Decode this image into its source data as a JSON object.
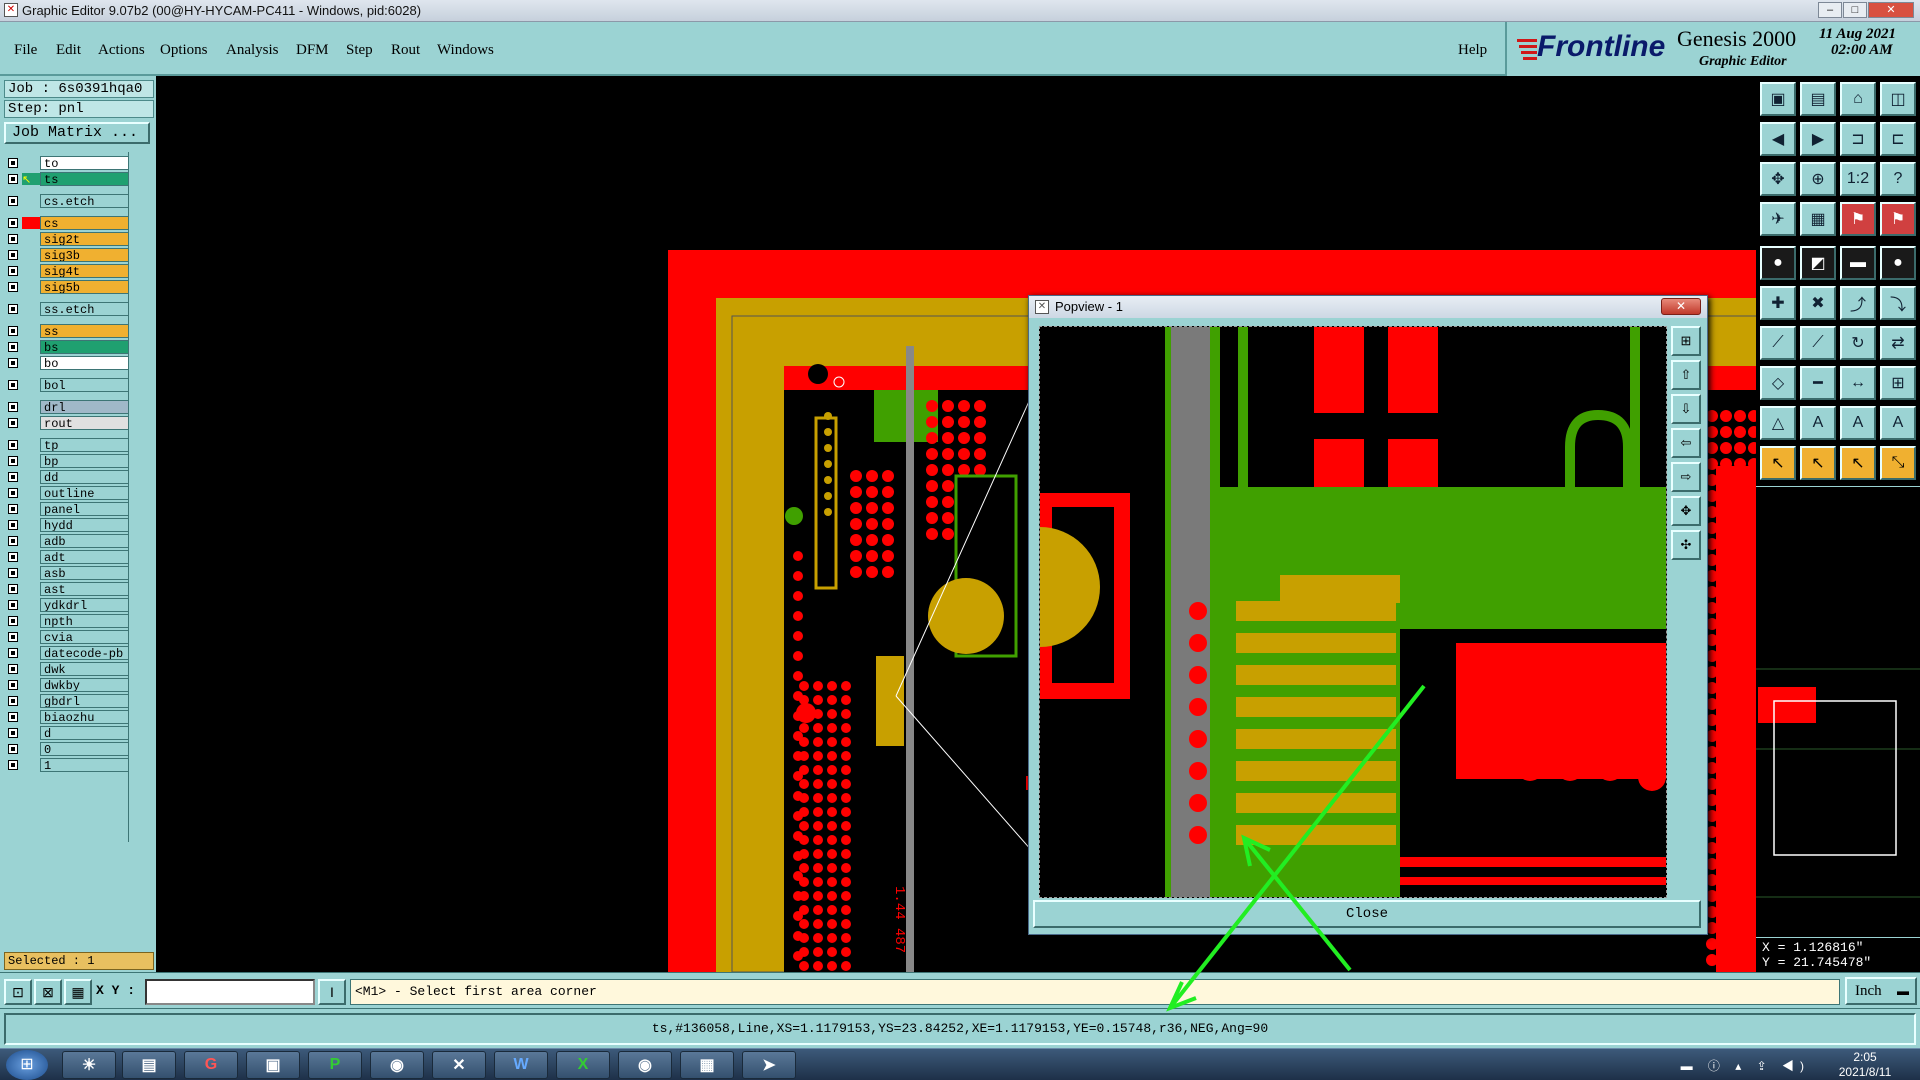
{
  "window": {
    "title": "Graphic Editor 9.07b2 (00@HY-HYCAM-PC411 - Windows, pid:6028)",
    "min": "–",
    "max": "□",
    "close": "✕"
  },
  "menu": [
    "File",
    "Edit",
    "Actions",
    "Options",
    "Analysis",
    "DFM",
    "Step",
    "Rout",
    "Windows"
  ],
  "help": "Help",
  "brand": {
    "logo": "Frontline",
    "product": "Genesis 2000",
    "sub": "Graphic Editor",
    "date": "11 Aug 2021",
    "time": "02:00 AM"
  },
  "job": "Job : 6s0391hqa0",
  "step": "Step: pnl",
  "job_matrix": "Job Matrix ...",
  "layers": [
    {
      "name": "to",
      "color": "#ffffff",
      "mark": ""
    },
    {
      "name": "ts",
      "color": "#1fa070",
      "mark": "sel"
    },
    {
      "name": "cs.etch",
      "color": "#9bd3d3",
      "mark": ""
    },
    {
      "name": "cs",
      "color": "#f0b030",
      "mark": "red"
    },
    {
      "name": "sig2t",
      "color": "#f0b030",
      "mark": ""
    },
    {
      "name": "sig3b",
      "color": "#f0b030",
      "mark": ""
    },
    {
      "name": "sig4t",
      "color": "#f0b030",
      "mark": ""
    },
    {
      "name": "sig5b",
      "color": "#f0b030",
      "mark": ""
    },
    {
      "name": "ss.etch",
      "color": "#9bd3d3",
      "mark": ""
    },
    {
      "name": "ss",
      "color": "#f0b030",
      "mark": ""
    },
    {
      "name": "bs",
      "color": "#1fa070",
      "mark": ""
    },
    {
      "name": "bo",
      "color": "#ffffff",
      "mark": ""
    },
    {
      "name": "bol",
      "color": "#9bd3d3",
      "mark": ""
    },
    {
      "name": "drl",
      "color": "#a0b8c8",
      "mark": ""
    },
    {
      "name": "rout",
      "color": "#e0e0e0",
      "mark": ""
    },
    {
      "name": "tp",
      "color": "#9bd3d3",
      "mark": ""
    },
    {
      "name": "bp",
      "color": "#9bd3d3",
      "mark": ""
    },
    {
      "name": "dd",
      "color": "#9bd3d3",
      "mark": ""
    },
    {
      "name": "outline",
      "color": "#9bd3d3",
      "mark": ""
    },
    {
      "name": "panel",
      "color": "#9bd3d3",
      "mark": ""
    },
    {
      "name": "hydd",
      "color": "#9bd3d3",
      "mark": ""
    },
    {
      "name": "adb",
      "color": "#9bd3d3",
      "mark": ""
    },
    {
      "name": "adt",
      "color": "#9bd3d3",
      "mark": ""
    },
    {
      "name": "asb",
      "color": "#9bd3d3",
      "mark": ""
    },
    {
      "name": "ast",
      "color": "#9bd3d3",
      "mark": ""
    },
    {
      "name": "ydkdrl",
      "color": "#9bd3d3",
      "mark": ""
    },
    {
      "name": "npth",
      "color": "#9bd3d3",
      "mark": ""
    },
    {
      "name": "cvia",
      "color": "#9bd3d3",
      "mark": ""
    },
    {
      "name": "datecode-pb",
      "color": "#9bd3d3",
      "mark": ""
    },
    {
      "name": "dwk",
      "color": "#9bd3d3",
      "mark": ""
    },
    {
      "name": "dwkby",
      "color": "#9bd3d3",
      "mark": ""
    },
    {
      "name": "gbdrl",
      "color": "#9bd3d3",
      "mark": ""
    },
    {
      "name": "biaozhu",
      "color": "#9bd3d3",
      "mark": ""
    },
    {
      "name": "d",
      "color": "#9bd3d3",
      "mark": ""
    },
    {
      "name": "0",
      "color": "#9bd3d3",
      "mark": ""
    },
    {
      "name": "1",
      "color": "#9bd3d3",
      "mark": ""
    }
  ],
  "selected": "Selected : 1",
  "popview": {
    "title": "Popview - 1",
    "close_label": "Close"
  },
  "coords": {
    "x": "X = 1.126816\"",
    "y": "Y = 21.745478\""
  },
  "xy_label": "X Y :",
  "xy_value": "",
  "prompt": "<M1> - Select first area corner",
  "unit": "Inch",
  "feature_info": "ts,#136058,Line,XS=1.1179153,YS=23.84252,XE=1.1179153,YE=0.15748,r36,NEG,Ang=90",
  "taskbar": {
    "time": "2:05",
    "date": "2021/8/11"
  },
  "colors": {
    "copper_red": "#ff0000",
    "copper_gold": "#c8a000",
    "solder_green": "#40a000",
    "panel": "#9bd3d3"
  }
}
